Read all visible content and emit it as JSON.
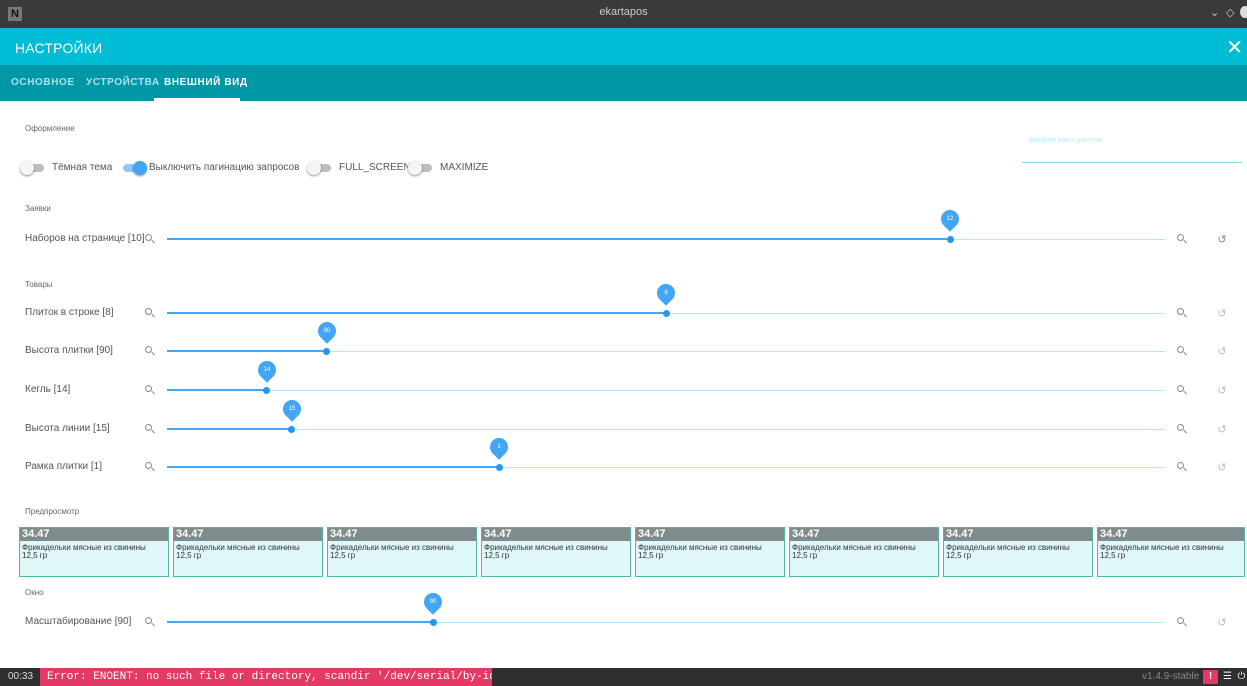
{
  "window": {
    "title": "ekartapos",
    "app_icon_glyph": "N"
  },
  "header": {
    "title": "НАСТРОЙКИ",
    "close_icon": "close-icon"
  },
  "tabs": [
    {
      "label": "ОСНОВНОЕ",
      "active": false
    },
    {
      "label": "УСТРОЙСТВА",
      "active": false
    },
    {
      "label": "ВНЕШНИЙ ВИД",
      "active": true
    }
  ],
  "access_key": {
    "label": "Введите ключ доступа",
    "value": "····"
  },
  "sections": {
    "appearance": "Оформление",
    "orders": "Заявки",
    "goods": "Товары",
    "preview": "Предпросмотр",
    "window": "Окно"
  },
  "toggles": [
    {
      "label": "Тёмная тема",
      "on": false
    },
    {
      "label": "Выключить пагинацию запросов",
      "on": true
    },
    {
      "label": "FULL_SCREEN",
      "on": false
    },
    {
      "label": "MAXIMIZE",
      "on": false
    }
  ],
  "sliders": [
    {
      "label": "Наборов на странице [10]",
      "value": "12",
      "level": 0.785,
      "reset_active": true
    },
    {
      "label": "Плиток в строке [8]",
      "value": "8",
      "level": 0.5,
      "reset_active": false
    },
    {
      "label": "Высота плитки [90]",
      "value": "90",
      "level": 0.16,
      "reset_active": false
    },
    {
      "label": "Кегль [14]",
      "value": "14",
      "level": 0.1,
      "reset_active": false
    },
    {
      "label": "Высота линии [15]",
      "value": "15",
      "level": 0.125,
      "reset_active": false
    },
    {
      "label": "Рамка плитки [1]",
      "value": "1",
      "level": 0.333,
      "reset_active": false
    },
    {
      "label": "Масштабирование [90]",
      "value": "90",
      "level": 0.267,
      "reset_active": false
    }
  ],
  "preview_tiles": [
    {
      "price": "34.47",
      "name": "Фрикадельки мясные из свинины",
      "weight": "12,5 гр"
    },
    {
      "price": "34.47",
      "name": "Фрикадельки мясные из свинины",
      "weight": "12,5 гр"
    },
    {
      "price": "34.47",
      "name": "Фрикадельки мясные из свинины",
      "weight": "12,5 гр"
    },
    {
      "price": "34.47",
      "name": "Фрикадельки мясные из свинины",
      "weight": "12,5 гр"
    },
    {
      "price": "34.47",
      "name": "Фрикадельки мясные из свинины",
      "weight": "12,5 гр"
    },
    {
      "price": "34.47",
      "name": "Фрикадельки мясные из свинины",
      "weight": "12,5 гр"
    },
    {
      "price": "34.47",
      "name": "Фрикадельки мясные из свинины",
      "weight": "12,5 гр"
    },
    {
      "price": "34.47",
      "name": "Фрикадельки мясные из свинины",
      "weight": "12,5 гр"
    }
  ],
  "status": {
    "time": "00:33",
    "error": "Error: ENOENT: no such file or directory, scandir '/dev/serial/by-id'",
    "version": "v1.4.9-stable"
  },
  "colors": {
    "primary": "#00bcd4",
    "tabs": "#0097a7",
    "accent": "#42a5f5",
    "error": "#e53965",
    "reset_active": "#9575cd"
  }
}
